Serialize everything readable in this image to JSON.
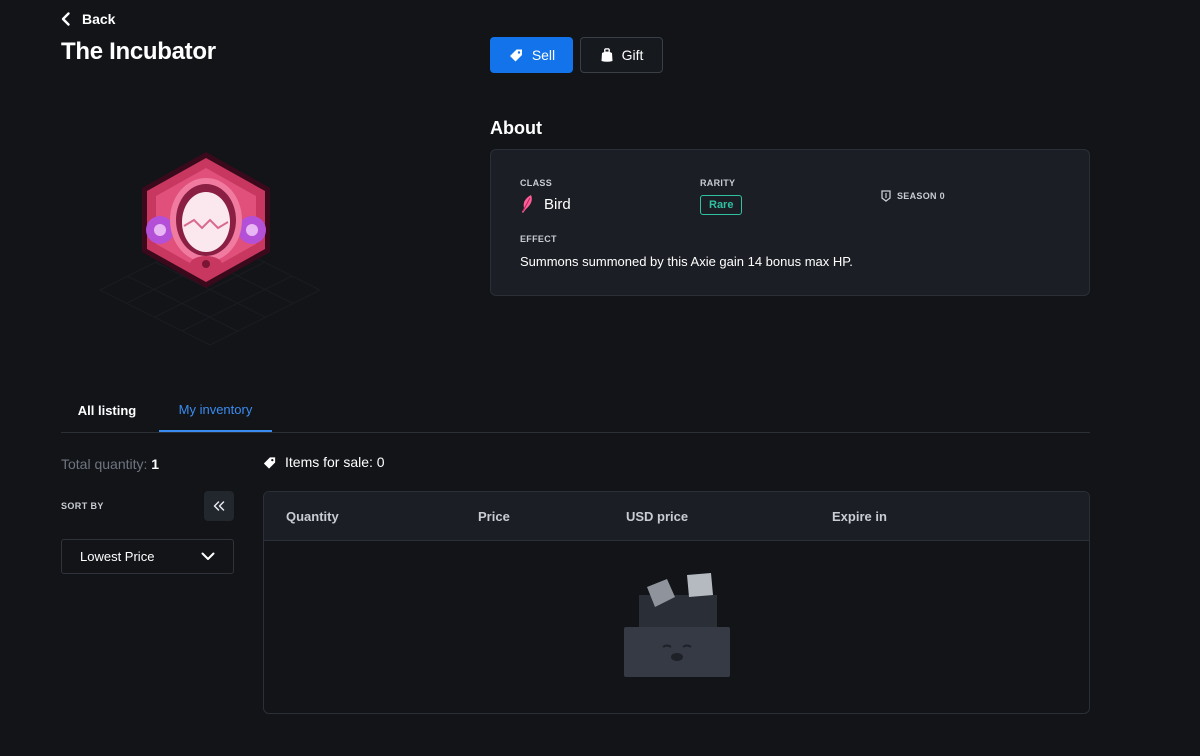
{
  "header": {
    "back_label": "Back",
    "title": "The Incubator"
  },
  "actions": {
    "sell_label": "Sell",
    "gift_label": "Gift",
    "sell_color": "#1273ea"
  },
  "about": {
    "heading": "About",
    "class_label": "CLASS",
    "class_value": "Bird",
    "rarity_label": "RARITY",
    "rarity_value": "Rare",
    "rarity_color": "#2fc1a2",
    "season_label": "SEASON 0",
    "effect_label": "EFFECT",
    "effect_text": "Summons summoned by this Axie gain 14 bonus max HP."
  },
  "tabs": [
    {
      "label": "All listing",
      "active": false
    },
    {
      "label": "My inventory",
      "active": true
    }
  ],
  "filters": {
    "total_quantity_label": "Total quantity:",
    "total_quantity_value": "1",
    "sort_by_label": "SORT BY",
    "sort_selected": "Lowest Price",
    "collapse_icon": "double-chevron-left-icon"
  },
  "listing": {
    "items_for_sale_label": "Items for sale: 0",
    "columns": [
      "Quantity",
      "Price",
      "USD price",
      "Expire in"
    ],
    "rows": []
  },
  "icons": {
    "back": "chevron-left-icon",
    "sell": "tag-icon",
    "gift": "gift-bag-icon",
    "class": "feather-icon",
    "season": "shield-icon",
    "sort_caret": "chevron-down-icon",
    "empty": "empty-box-icon"
  }
}
